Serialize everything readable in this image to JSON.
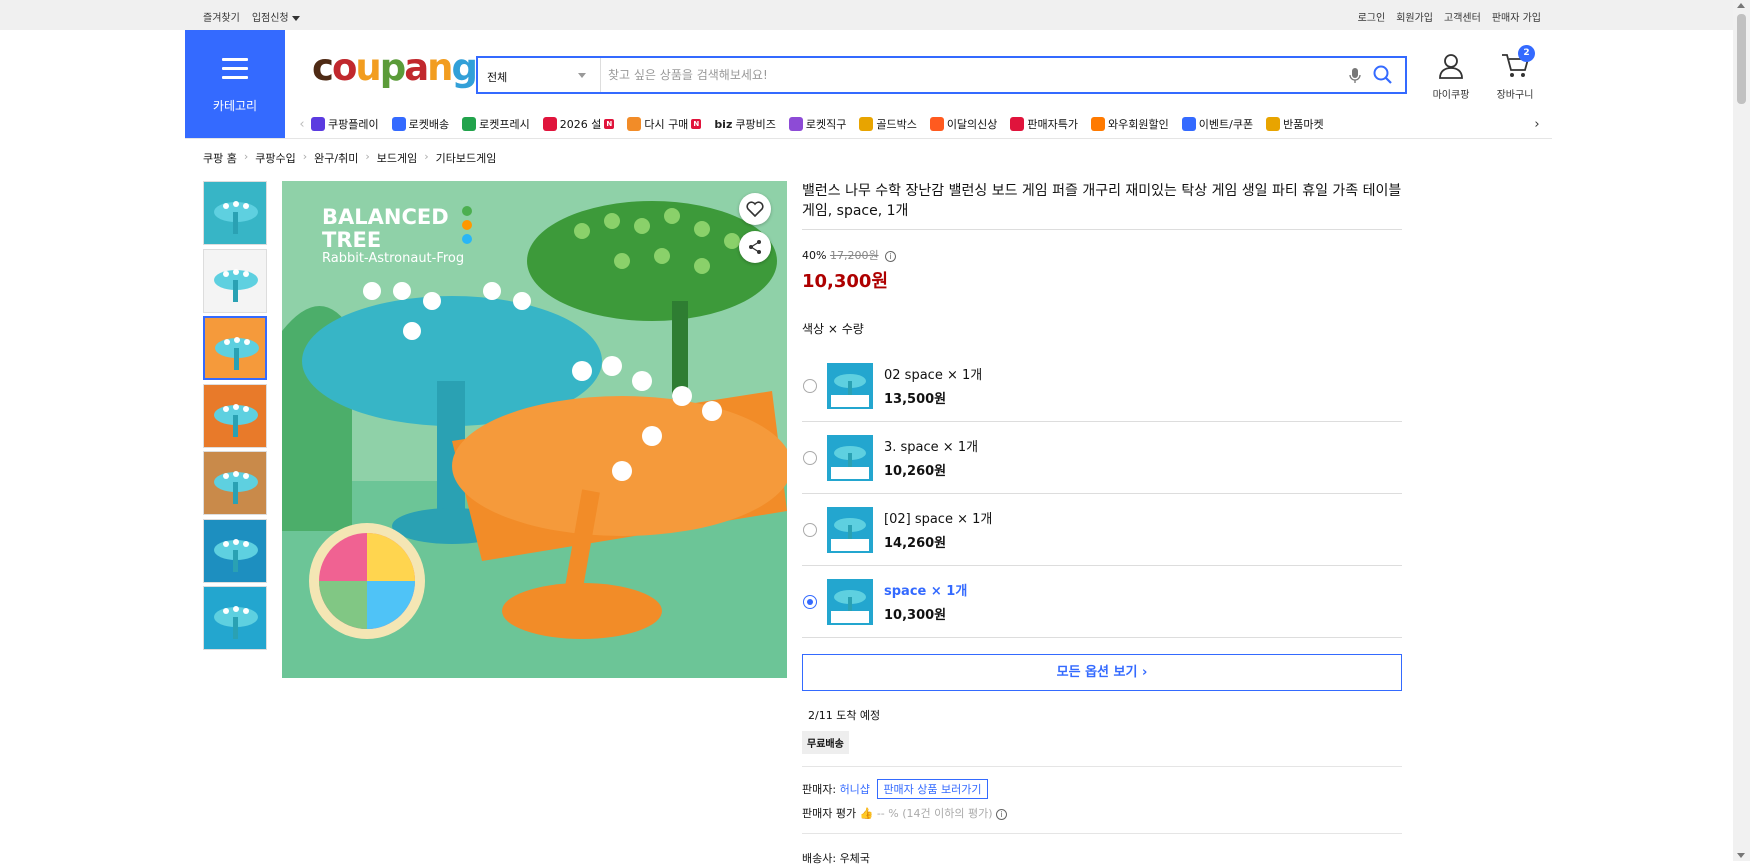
{
  "topbar": {
    "favorites": "즐겨찾기",
    "seller_apply": "입점신청",
    "login": "로그인",
    "signup": "회원가입",
    "support": "고객센터",
    "seller_join": "판매자 가입"
  },
  "header": {
    "category_label": "카테고리",
    "logo_text": "coupang",
    "search_scope": "전체",
    "search_placeholder": "찾고 싶은 상품을 검색해보세요!",
    "mypage": "마이쿠팡",
    "cart": "장바구니",
    "cart_count": "2"
  },
  "nav": [
    {
      "label": "쿠팡플레이",
      "icon": "play-icon",
      "color": "#5b3be0"
    },
    {
      "label": "로켓배송",
      "icon": "rocket-icon",
      "color": "#346aff"
    },
    {
      "label": "로켓프레시",
      "icon": "rocket-fresh-icon",
      "color": "#22a34c"
    },
    {
      "label": "2026 설",
      "icon": "gift-icon",
      "color": "#e0143c",
      "new": "N"
    },
    {
      "label": "다시 구매",
      "icon": "rebuy-icon",
      "color": "#f28c28",
      "new": "N"
    },
    {
      "label": "쿠팡비즈",
      "icon": "biz-icon",
      "color": "#111",
      "prefix": "biz"
    },
    {
      "label": "로켓직구",
      "icon": "global-icon",
      "color": "#8d4bd6"
    },
    {
      "label": "골드박스",
      "icon": "goldbox-icon",
      "color": "#e8a400"
    },
    {
      "label": "이달의신상",
      "icon": "new-bag-icon",
      "color": "#ff5a1f"
    },
    {
      "label": "판매자특가",
      "icon": "sale-icon",
      "color": "#e0143c"
    },
    {
      "label": "와우회원할인",
      "icon": "wow-icon",
      "color": "#ff7a00"
    },
    {
      "label": "이벤트/쿠폰",
      "icon": "coupon-icon",
      "color": "#346aff"
    },
    {
      "label": "반품마켓",
      "icon": "market-icon",
      "color": "#e8a400"
    }
  ],
  "breadcrumb": [
    "쿠팡 홈",
    "쿠팡수입",
    "완구/취미",
    "보드게임",
    "기타보드게임"
  ],
  "product": {
    "image_text": {
      "line1": "BALANCED",
      "line2": "TREE",
      "line3": "Rabbit-Astronaut-Frog"
    },
    "title": "밸런스 나무 수학 장난감 밸런싱 보드 게임 퍼즐 개구리 재미있는 탁상 게임 생일 파티 휴일 가족 테이블 게임, space, 1개",
    "discount": "40%",
    "original_price": "17,200원",
    "price": "10,300원",
    "option_label": "색상 × 수량",
    "options": [
      {
        "name": "02 space × 1개",
        "price": "13,500원",
        "selected": false
      },
      {
        "name": "3. space × 1개",
        "price": "10,260원",
        "selected": false
      },
      {
        "name": "[02] space × 1개",
        "price": "14,260원",
        "selected": false
      },
      {
        "name": "space × 1개",
        "price": "10,300원",
        "selected": true
      }
    ],
    "all_options": "모든 옵션 보기 ›",
    "arrival": "2/11 도착 예정",
    "free_shipping": "무료배송",
    "seller_prefix": "판매자: ",
    "seller_name": "허니샵",
    "seller_link": "판매자 상품 보러가기",
    "seller_rating_label": "판매자 평가",
    "seller_rating_value": "-- %",
    "seller_rating_note": "(14건 이하의 평가)",
    "courier_label": "배송사: ",
    "courier": "우체국"
  }
}
